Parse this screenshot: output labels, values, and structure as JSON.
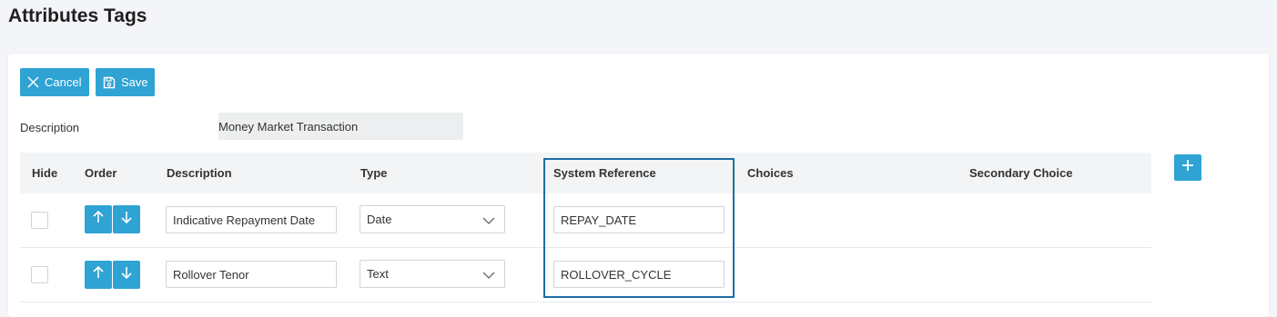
{
  "page": {
    "title": "Attributes Tags"
  },
  "toolbar": {
    "cancel_label": "Cancel",
    "save_label": "Save"
  },
  "form": {
    "description_label": "Description",
    "description_value": "Money Market Transaction"
  },
  "table": {
    "headers": {
      "hide": "Hide",
      "order": "Order",
      "description": "Description",
      "type": "Type",
      "system_reference": "System Reference",
      "choices": "Choices",
      "secondary_choice": "Secondary Choice"
    },
    "rows": [
      {
        "hidden": false,
        "description": "Indicative Repayment Date",
        "type": "Date",
        "system_reference": "REPAY_DATE"
      },
      {
        "hidden": false,
        "description": "Rollover Tenor",
        "type": "Text",
        "system_reference": "ROLLOVER_CYCLE"
      }
    ]
  },
  "colors": {
    "accent": "#2ea3d4",
    "highlight_border": "#1c6ea4"
  },
  "icons": {
    "cancel": "close-icon",
    "save": "save-icon",
    "up": "arrow-up-icon",
    "down": "arrow-down-icon",
    "add": "plus-icon",
    "select": "chevron-down-icon"
  }
}
